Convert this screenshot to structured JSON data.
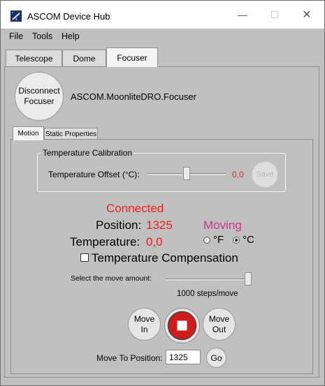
{
  "window": {
    "title": "ASCOM Device Hub",
    "minimize_glyph": "—",
    "maximize_glyph": "☐",
    "close_glyph": "✕"
  },
  "menu": {
    "items": [
      "File",
      "Tools",
      "Help"
    ]
  },
  "tabs": [
    {
      "label": "Telescope"
    },
    {
      "label": "Dome"
    },
    {
      "label": "Focuser",
      "active": true
    }
  ],
  "focuser": {
    "disconnect_button": {
      "line1": "Disconnect",
      "line2": "Focuser"
    },
    "device_name": "ASCOM.MoonliteDRO.Focuser"
  },
  "subtabs": [
    {
      "label": "Motion",
      "active": true
    },
    {
      "label": "Static Properties"
    }
  ],
  "temperature_calibration": {
    "group_title": "Temperature Calibration",
    "offset_label": "Temperature Offset (°C):",
    "offset_value": "0,0",
    "offset_slider_fraction": 0.5,
    "save_label": "Save"
  },
  "status": {
    "connected": "Connected",
    "position_label": "Position:",
    "position_value": "1325",
    "moving": "Moving",
    "temperature_label": "Temperature:",
    "temperature_value": "0,0",
    "unit_f": "°F",
    "unit_c": "°C",
    "selected_unit": "C",
    "temp_comp_label": "Temperature Compensation",
    "temp_comp_checked": false
  },
  "move": {
    "amount_label": "Select the move amount:",
    "amount_value": "1000 steps/move",
    "amount_slider_fraction": 1.0,
    "move_in": {
      "line1": "Move",
      "line2": "In"
    },
    "move_out": {
      "line1": "Move",
      "line2": "Out"
    },
    "goto_label": "Move To Position:",
    "goto_value": "1325",
    "go_label": "Go"
  },
  "colors": {
    "red_text": "#ef1e1e",
    "moving_text": "#c8358c",
    "stop_button": "#d11a1a"
  }
}
